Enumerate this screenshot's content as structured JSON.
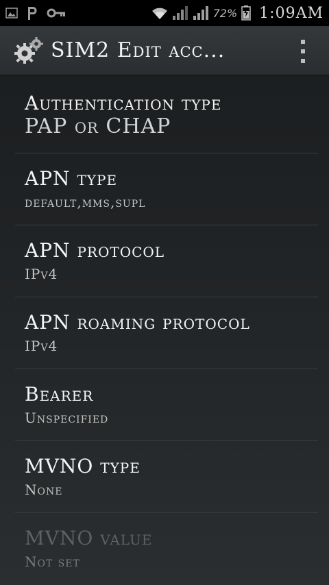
{
  "status_bar": {
    "left_icons": [
      "gallery-icon",
      "p-icon",
      "key-icon"
    ],
    "right_icons": [
      "wifi-icon",
      "signal-icon-1",
      "signal-icon-2",
      "battery-icon"
    ],
    "battery_percent": "72%",
    "time": "1:09AM"
  },
  "action_bar": {
    "title": "SIM2 Edit acc...",
    "app_icon": "gears-icon",
    "overflow_icon": "overflow-menu-icon"
  },
  "settings": [
    {
      "title": "Authentication type",
      "summary": "PAP or CHAP",
      "enabled": true
    },
    {
      "title": "APN type",
      "summary": "default,mms,supl",
      "enabled": true
    },
    {
      "title": "APN protocol",
      "summary": "IPv4",
      "enabled": true
    },
    {
      "title": "APN roaming protocol",
      "summary": "IPv4",
      "enabled": true
    },
    {
      "title": "Bearer",
      "summary": "Unspecified",
      "enabled": true
    },
    {
      "title": "MVNO type",
      "summary": "None",
      "enabled": true
    },
    {
      "title": "MVNO value",
      "summary": "Not set",
      "enabled": false
    }
  ],
  "colors": {
    "background": "#222527",
    "status_bar": "#000000",
    "action_bar": "#2f3234",
    "divider": "#3a3d40",
    "text_primary": "#f4f4f4",
    "text_secondary": "#c4c4c4",
    "text_disabled": "#5e6163"
  }
}
